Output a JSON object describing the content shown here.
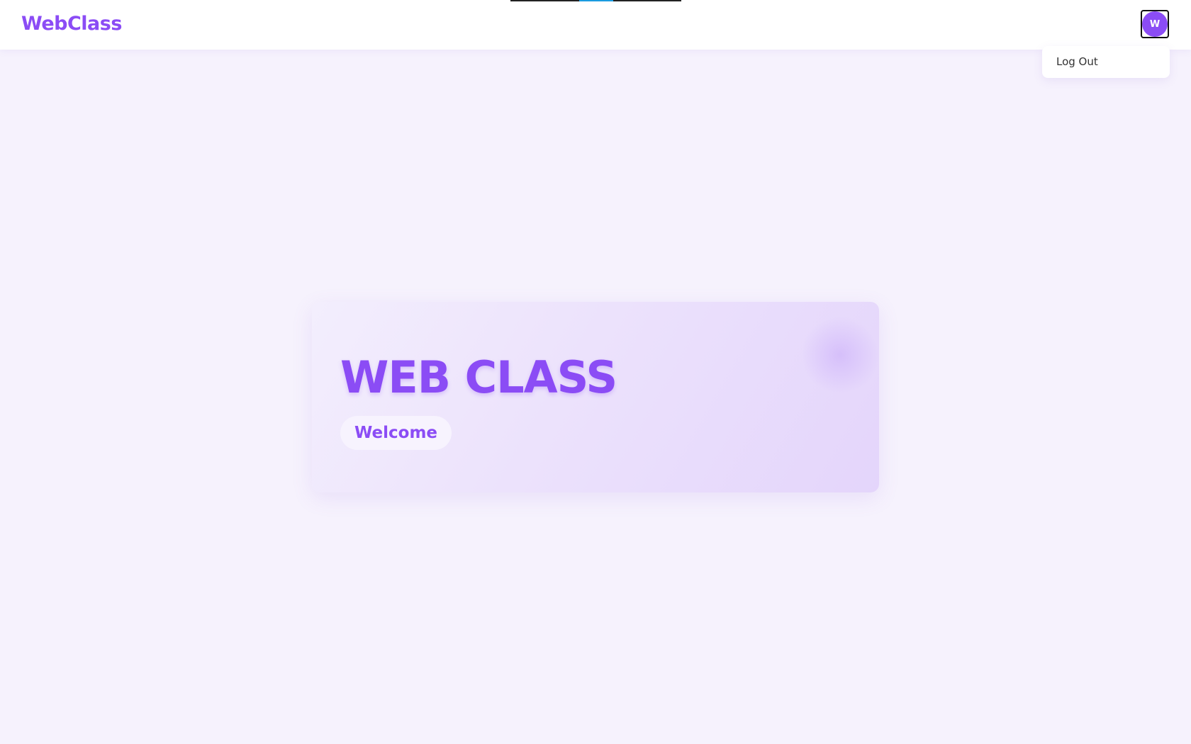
{
  "header": {
    "brand": "WebClass",
    "avatar_initial": "W"
  },
  "user_menu": {
    "items": [
      {
        "label": "Log Out"
      }
    ]
  },
  "hero": {
    "title": "WEB CLASS",
    "subtitle": "Welcome"
  },
  "colors": {
    "accent": "#8b4cf5",
    "page_background": "#f6f2fd",
    "loading_bar": "#1a9be0"
  }
}
